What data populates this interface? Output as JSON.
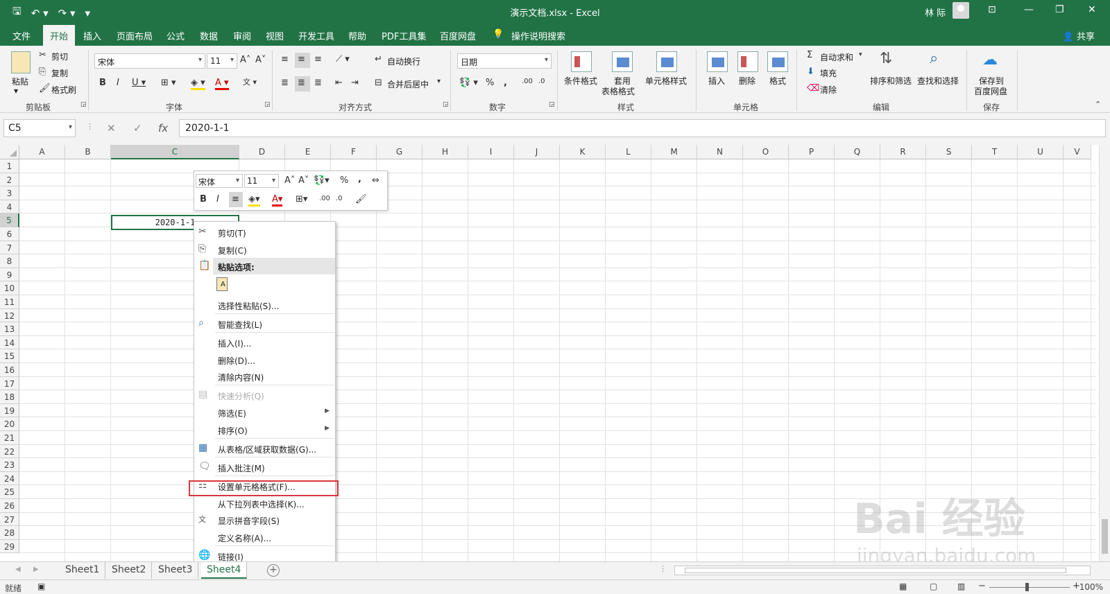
{
  "window": {
    "title": "演示文档.xlsx - Excel",
    "user": "林 际"
  },
  "menu": {
    "items": [
      "文件",
      "开始",
      "插入",
      "页面布局",
      "公式",
      "数据",
      "审阅",
      "视图",
      "开发工具",
      "帮助",
      "PDF工具集",
      "百度网盘"
    ],
    "active": "开始",
    "search": "操作说明搜索",
    "share": "共享"
  },
  "ribbon": {
    "clipboard": {
      "label": "剪贴板",
      "paste": "粘贴",
      "cut": "剪切",
      "copy": "复制",
      "format_painter": "格式刷"
    },
    "font": {
      "label": "字体",
      "name": "宋体",
      "size": "11"
    },
    "alignment": {
      "label": "对齐方式",
      "wrap": "自动换行",
      "merge": "合并后居中"
    },
    "number": {
      "label": "数字",
      "format": "日期"
    },
    "styles": {
      "label": "样式",
      "conditional": "条件格式",
      "table_line1": "套用",
      "table_line2": "表格格式",
      "cell_styles": "单元格样式"
    },
    "cells": {
      "label": "单元格",
      "insert": "插入",
      "delete": "删除",
      "format": "格式"
    },
    "editing": {
      "label": "编辑",
      "autosum": "自动求和",
      "fill": "填充",
      "clear": "清除",
      "sort": "排序和筛选",
      "find": "查找和选择"
    },
    "save": {
      "label": "保存",
      "line1": "保存到",
      "line2": "百度网盘"
    }
  },
  "formula_bar": {
    "name_box": "C5",
    "value": "2020-1-1"
  },
  "grid": {
    "columns": [
      "A",
      "B",
      "C",
      "D",
      "E",
      "F",
      "G",
      "H",
      "I",
      "J",
      "K",
      "L",
      "M",
      "N",
      "O",
      "P",
      "Q",
      "R",
      "S",
      "T",
      "U",
      "V"
    ],
    "rows": [
      "1",
      "2",
      "3",
      "4",
      "5",
      "6",
      "7",
      "8",
      "9",
      "10",
      "11",
      "12",
      "13",
      "14",
      "15",
      "16",
      "17",
      "18",
      "19",
      "20",
      "21",
      "22",
      "23",
      "24",
      "25",
      "26",
      "27",
      "28",
      "29"
    ],
    "active_cell_text": "2020-1-1"
  },
  "mini_toolbar": {
    "font": "宋体",
    "size": "11",
    "percent": "%",
    "comma": ","
  },
  "context_menu": {
    "items": [
      {
        "label": "剪切(T)",
        "icon": "scissors-icon"
      },
      {
        "label": "复制(C)",
        "icon": "copy-icon"
      },
      {
        "label": "粘贴选项:",
        "icon": "clipboard-icon"
      },
      {
        "label": "选择性粘贴(S)...",
        "icon": ""
      },
      {
        "label": "智能查找(L)",
        "icon": "smart-lookup-icon"
      },
      {
        "label": "插入(I)...",
        "icon": ""
      },
      {
        "label": "删除(D)...",
        "icon": ""
      },
      {
        "label": "清除内容(N)",
        "icon": ""
      },
      {
        "label": "快速分析(Q)",
        "icon": "quick-analysis-icon"
      },
      {
        "label": "筛选(E)",
        "icon": ""
      },
      {
        "label": "排序(O)",
        "icon": ""
      },
      {
        "label": "从表格/区域获取数据(G)...",
        "icon": "table-icon"
      },
      {
        "label": "插入批注(M)",
        "icon": "comment-icon"
      },
      {
        "label": "设置单元格格式(F)...",
        "icon": "format-cells-icon"
      },
      {
        "label": "从下拉列表中选择(K)...",
        "icon": ""
      },
      {
        "label": "显示拼音字段(S)",
        "icon": "phonetic-icon"
      },
      {
        "label": "定义名称(A)...",
        "icon": ""
      },
      {
        "label": "链接(I)",
        "icon": "link-icon"
      }
    ]
  },
  "sheets": {
    "tabs": [
      "Sheet1",
      "Sheet2",
      "Sheet3",
      "Sheet4"
    ],
    "active": "Sheet4"
  },
  "status": {
    "ready": "就绪",
    "zoom": "100%"
  },
  "watermark": {
    "main": "Bai 经验",
    "sub": "jingyan.baidu.com"
  }
}
